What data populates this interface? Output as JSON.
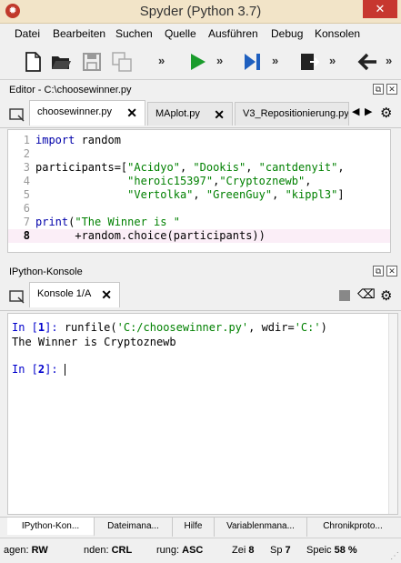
{
  "window": {
    "title": "Spyder (Python 3.7)",
    "close_glyph": "✕"
  },
  "menu": [
    "Datei",
    "Bearbeiten",
    "Suchen",
    "Quelle",
    "Ausführen",
    "Debug",
    "Konsolen"
  ],
  "toolbar": {
    "more_glyph": "»"
  },
  "editor": {
    "header": "Editor - C:\\choosewinner.py",
    "tabs": [
      {
        "label": "choosewinner.py",
        "active": true
      },
      {
        "label": "MAplot.py",
        "active": false
      },
      {
        "label": "V3_Repositionierung.py",
        "active": false
      }
    ],
    "lines": [
      {
        "n": "1",
        "parts": [
          [
            "kw",
            "import"
          ],
          [
            "",
            " random"
          ]
        ]
      },
      {
        "n": "2",
        "parts": []
      },
      {
        "n": "3",
        "parts": [
          [
            "",
            "participants=["
          ],
          [
            "str",
            "\"Acidyo\""
          ],
          [
            "",
            ", "
          ],
          [
            "str",
            "\"Dookis\""
          ],
          [
            "",
            ", "
          ],
          [
            "str",
            "\"cantdenyit\""
          ],
          [
            "",
            ","
          ]
        ]
      },
      {
        "n": "4",
        "parts": [
          [
            "",
            "              "
          ],
          [
            "str",
            "\"heroic15397\""
          ],
          [
            "",
            ","
          ],
          [
            "str",
            "\"Cryptoznewb\""
          ],
          [
            "",
            ","
          ]
        ]
      },
      {
        "n": "5",
        "parts": [
          [
            "",
            "              "
          ],
          [
            "str",
            "\"Vertolka\""
          ],
          [
            "",
            ", "
          ],
          [
            "str",
            "\"GreenGuy\""
          ],
          [
            "",
            ", "
          ],
          [
            "str",
            "\"kippl3\""
          ],
          [
            "",
            "]"
          ]
        ]
      },
      {
        "n": "6",
        "parts": []
      },
      {
        "n": "7",
        "parts": [
          [
            "kw",
            "print"
          ],
          [
            "",
            "("
          ],
          [
            "str",
            "\"The Winner is \""
          ]
        ]
      },
      {
        "n": "8",
        "parts": [
          [
            "",
            "      +random.choice(participants))"
          ]
        ],
        "highlight": true
      }
    ]
  },
  "console": {
    "header": "IPython-Konsole",
    "tab": "Konsole 1/A",
    "in1_prefix": "In [",
    "in1_num": "1",
    "in1_suffix": "]: ",
    "in1_cmd": "runfile(",
    "in1_arg1": "'C:/choosewinner.py'",
    "in1_mid": ", wdir=",
    "in1_arg2": "'C:'",
    "in1_end": ")",
    "output": "The Winner is Cryptoznewb",
    "in2_prefix": "In [",
    "in2_num": "2",
    "in2_suffix": "]: "
  },
  "bottom_tabs": [
    "IPython-Kon...",
    "Dateimana...",
    "Hilfe",
    "Variablenmana...",
    "Chronikproto..."
  ],
  "status": {
    "perm_label": "agen:",
    "perm_value": "RW",
    "eol_label": "nden:",
    "eol_value": "CRL",
    "enc_label": "rung:",
    "enc_value": "ASC",
    "line_label": "Zei",
    "line_value": "8",
    "col_label": "Sp",
    "col_value": "7",
    "mem_label": "Speic",
    "mem_value": "58 %"
  }
}
